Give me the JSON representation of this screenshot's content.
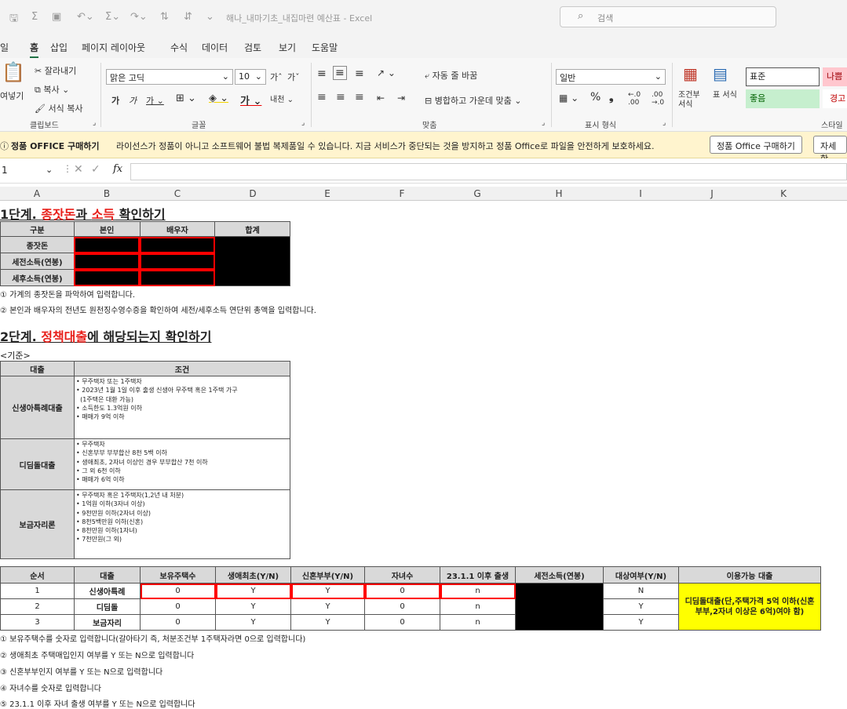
{
  "titlebar": {
    "doc_title": "해나_내마기초_내집마련 예산표 - Excel",
    "search_placeholder": "검색"
  },
  "menu": [
    "일",
    "홈",
    "삽입",
    "페이지 레이아웃",
    "수식",
    "데이터",
    "검토",
    "보기",
    "도움말"
  ],
  "ribbon": {
    "paste": "여넣기",
    "cut": "잘라내기",
    "copy": "복사",
    "format_copy": "서식 복사",
    "clipboard": "클립보드",
    "font_name": "맑은 고딕",
    "font_size": "10",
    "font_group": "글꼴",
    "wrap": "자동 줄 바꿈",
    "merge": "병합하고 가운데 맞춤",
    "align_group": "맞춤",
    "number_format": "일반",
    "number_group": "표시 형식",
    "cond_format": "조건부 서식",
    "table_format": "표 서식",
    "style_normal": "표준",
    "style_bad": "나쁨",
    "style_good": "좋음",
    "style_warn": "경고",
    "style_group": "스타일"
  },
  "msgbar": {
    "title": "정품 OFFICE 구매하기",
    "text": "라이선스가 정품이 아니고 소프트웨어 불법 복제품일 수 있습니다. 지금 서비스가 중단되는 것을 방지하고 정품 Office로 파일을 안전하게 보호하세요.",
    "btn_buy": "정품 Office 구매하기",
    "btn_more": "자세한"
  },
  "formula_bar": {
    "cell_ref": "1",
    "fx": "fx",
    "value": ""
  },
  "columns": [
    "A",
    "B",
    "C",
    "D",
    "E",
    "F",
    "G",
    "H",
    "I",
    "J",
    "K"
  ],
  "step1": {
    "title_a": "1단계. ",
    "title_red1": "종잣돈",
    "title_b": "과 ",
    "title_red2": "소득",
    "title_c": " 확인하기",
    "headers": [
      "구분",
      "본인",
      "배우자",
      "합계"
    ],
    "rows": [
      "종잣돈",
      "세전소득(연봉)",
      "세후소득(연봉)"
    ],
    "notes": [
      "① 가계의 종잣돈을 파악하여 입력합니다.",
      "② 본인과 배우자의 전년도 원천징수영수증을 확인하여 세전/세후소득 연단위 총액을 입력합니다."
    ]
  },
  "step2": {
    "title_a": "2단계. ",
    "title_red": "정책대출",
    "title_b": "에 해당되는지 확인하기",
    "criteria_label": "<기준>",
    "crit_headers": [
      "대출",
      "조건"
    ],
    "crit_rows": [
      {
        "name": "신생아특례대출",
        "conds": [
          "• 무주택자 또는 1주택자",
          "• 2023년 1월 1일 이후 출생 신생아 무주택 혹은 1주택 가구",
          "  (1주택은 대환 가능)",
          "• 소득한도 1.3억원 이하",
          "• 매매가 9억 이하"
        ]
      },
      {
        "name": "디딤돌대출",
        "conds": [
          "• 무주택자",
          "• 신혼부부 부부합산 8천 5백 이하",
          "• 생애최초, 2자녀 이상인 경우 부부합산 7천 이하",
          "• 그 외 6천 이하",
          "• 매매가 6억 이하"
        ]
      },
      {
        "name": "보금자리론",
        "conds": [
          "• 무주택자 혹은 1주택자(1,2년 내 처분)",
          "• 1억원 이하(3자녀 이상)",
          "• 9천만원 이하(2자녀 이상)",
          "• 8천5백만원 이하(신혼)",
          "• 8천만원 이하(1자녀)",
          "• 7천만원(그 외)"
        ]
      }
    ],
    "main_headers": [
      "순서",
      "대출",
      "보유주택수",
      "생애최초(Y/N)",
      "신혼부부(Y/N)",
      "자녀수",
      "23.1.1 이후 출생",
      "세전소득(연봉)",
      "대상여부(Y/N)",
      "이용가능 대출"
    ],
    "main_rows": [
      [
        "1",
        "신생아특례",
        "0",
        "Y",
        "Y",
        "0",
        "n",
        "",
        "N"
      ],
      [
        "2",
        "디딤돌",
        "0",
        "Y",
        "Y",
        "0",
        "n",
        "",
        "Y"
      ],
      [
        "3",
        "보금자리",
        "0",
        "Y",
        "Y",
        "0",
        "n",
        "",
        "Y"
      ]
    ],
    "available_loan": "디딤돌대출(단,주택가격 5억 이하(신혼부부,2자녀 이상은 6억)여야 함)",
    "notes": [
      "① 보유주택수를 숫자로 입력합니다(갈아타기 즉, 처분조건부 1주택자라면 0으로 입력합니다)",
      "② 생애최초 주택매입인지 여부를 Y 또는 N으로 입력합니다",
      "③ 신혼부부인지 여부를 Y 또는 N으로 입력합니다",
      "④ 자녀수를 숫자로 입력합니다",
      "⑤ 23.1.1 이후 자녀 출생 여부를 Y 또는 N으로 입력합니다"
    ]
  }
}
